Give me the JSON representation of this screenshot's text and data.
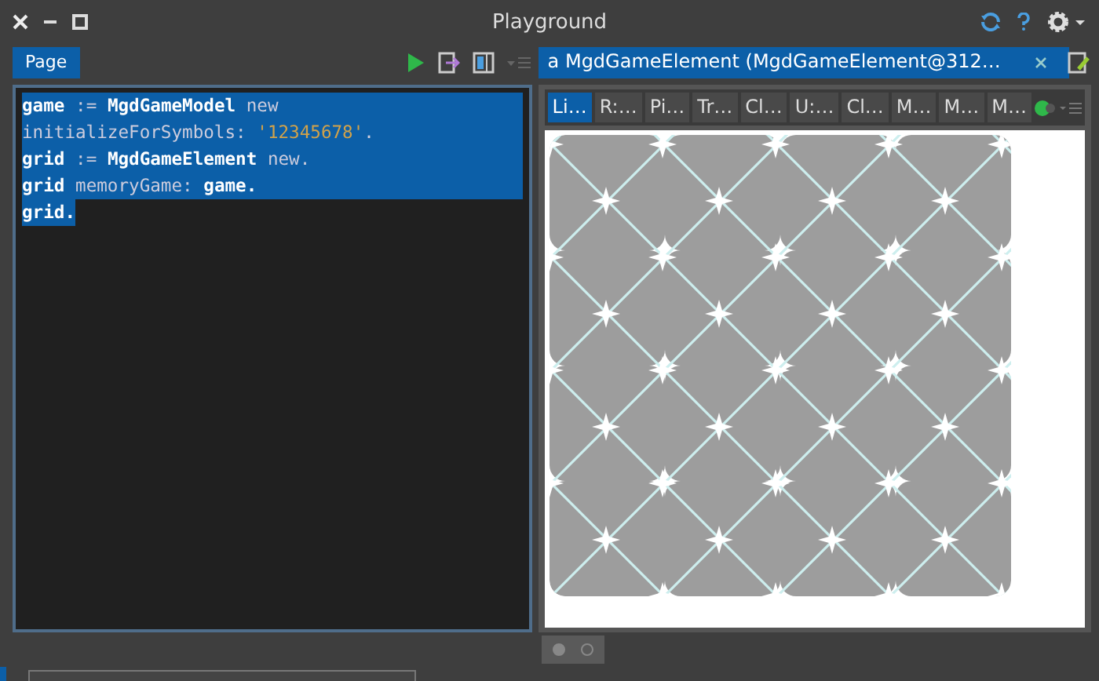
{
  "window": {
    "title": "Playground"
  },
  "left_pane": {
    "tab": {
      "label": "Page",
      "selected": true
    },
    "code_lines": [
      [
        {
          "text": "game",
          "kind": "bold"
        },
        {
          "text": " := ",
          "kind": "plain"
        },
        {
          "text": "MgdGameModel",
          "kind": "bold"
        },
        {
          "text": " new",
          "kind": "plain"
        }
      ],
      [
        {
          "text": "initializeForSymbols: ",
          "kind": "plain"
        },
        {
          "text": "'12345678'",
          "kind": "string"
        },
        {
          "text": ".",
          "kind": "plain"
        }
      ],
      [
        {
          "text": "grid",
          "kind": "bold"
        },
        {
          "text": " := ",
          "kind": "plain"
        },
        {
          "text": "MgdGameElement",
          "kind": "bold"
        },
        {
          "text": " new.",
          "kind": "plain"
        }
      ],
      [
        {
          "text": "grid",
          "kind": "bold"
        },
        {
          "text": " memoryGame: ",
          "kind": "plain"
        },
        {
          "text": "game.",
          "kind": "bold"
        }
      ],
      [
        {
          "text": "grid.",
          "kind": "bold"
        }
      ]
    ]
  },
  "right_pane": {
    "tab": {
      "label": "a MgdGameElement (MgdGameElement@312…",
      "selected": true
    },
    "view_tabs": [
      {
        "label": "Li…",
        "selected": true
      },
      {
        "label": "R:…",
        "selected": false
      },
      {
        "label": "Pi…",
        "selected": false
      },
      {
        "label": "Tr…",
        "selected": false
      },
      {
        "label": "Cl…",
        "selected": false
      },
      {
        "label": "U:…",
        "selected": false
      },
      {
        "label": "Cl…",
        "selected": false
      },
      {
        "label": "M…",
        "selected": false
      },
      {
        "label": "M…",
        "selected": false
      },
      {
        "label": "M…",
        "selected": false
      }
    ]
  },
  "pager": [
    {
      "selected": true
    },
    {
      "selected": false
    }
  ]
}
